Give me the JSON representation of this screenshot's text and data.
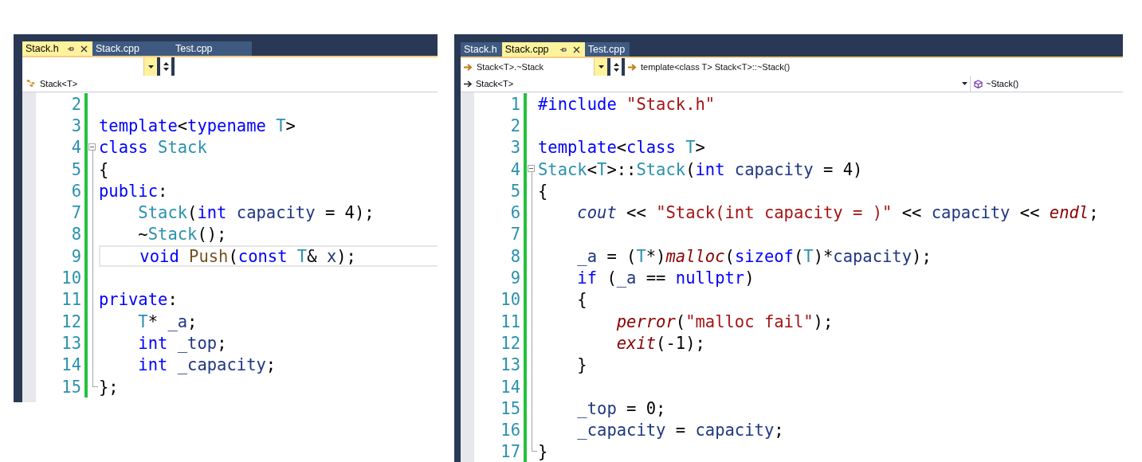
{
  "panes": [
    {
      "tabs": [
        {
          "label": "Stack.h",
          "selected": true
        },
        {
          "label": "Stack.cpp",
          "selected": false
        },
        {
          "label": "Test.cpp",
          "selected": false
        }
      ],
      "nav": {
        "breadcrumb": "Stack<T>"
      },
      "lines": [
        {
          "number": "2",
          "current": false
        },
        {
          "number": "3",
          "current": false,
          "tokens": [
            {
              "kind": "kw",
              "t": "template"
            },
            {
              "kind": "plain",
              "t": "<"
            },
            {
              "kind": "kw",
              "t": "typename"
            },
            {
              "kind": "type",
              "t": " T"
            },
            {
              "kind": "plain",
              "t": ">"
            }
          ]
        },
        {
          "number": "4",
          "current": false,
          "expanded": true,
          "tokens": [
            {
              "kind": "kw",
              "t": "class"
            },
            {
              "kind": "type",
              "t": " Stack"
            }
          ],
          "children": [
            {
              "number": "5",
              "current": false,
              "tokens": [
                {
                  "kind": "plain",
                  "t": "{"
                }
              ]
            },
            {
              "number": "6",
              "current": false,
              "tokens": [
                {
                  "kind": "kw",
                  "t": "public"
                },
                {
                  "kind": "plain",
                  "t": ":"
                }
              ]
            },
            {
              "number": "7",
              "current": false,
              "tokens": [
                {
                  "kind": "type",
                  "t": "    Stack"
                },
                {
                  "kind": "plain",
                  "t": "("
                },
                {
                  "kind": "kw",
                  "t": "int"
                },
                {
                  "kind": "id",
                  "t": " capacity"
                },
                {
                  "kind": "plain",
                  "t": " = 4);"
                }
              ]
            },
            {
              "number": "8",
              "current": false,
              "tokens": [
                {
                  "kind": "plain",
                  "t": "    ~"
                },
                {
                  "kind": "type",
                  "t": "Stack"
                },
                {
                  "kind": "plain",
                  "t": "();"
                }
              ]
            },
            {
              "number": "9",
              "current": true,
              "tokens": [
                {
                  "kind": "kw",
                  "t": "    void"
                },
                {
                  "kind": "fn",
                  "t": " Push"
                },
                {
                  "kind": "plain",
                  "t": "("
                },
                {
                  "kind": "kw",
                  "t": "const"
                },
                {
                  "kind": "type",
                  "t": " T"
                },
                {
                  "kind": "plain",
                  "t": "& "
                },
                {
                  "kind": "id",
                  "t": "x"
                },
                {
                  "kind": "plain",
                  "t": ");"
                }
              ]
            },
            {
              "number": "10",
              "current": false
            },
            {
              "number": "11",
              "current": false,
              "tokens": [
                {
                  "kind": "kw",
                  "t": "private"
                },
                {
                  "kind": "plain",
                  "t": ":"
                }
              ]
            },
            {
              "number": "12",
              "current": false,
              "tokens": [
                {
                  "kind": "type",
                  "t": "    T"
                },
                {
                  "kind": "plain",
                  "t": "* "
                },
                {
                  "kind": "id",
                  "t": "_a"
                },
                {
                  "kind": "plain",
                  "t": ";"
                }
              ]
            },
            {
              "number": "13",
              "current": false,
              "tokens": [
                {
                  "kind": "kw",
                  "t": "    int"
                },
                {
                  "kind": "id",
                  "t": " _top"
                },
                {
                  "kind": "plain",
                  "t": ";"
                }
              ]
            },
            {
              "number": "14",
              "current": false,
              "tokens": [
                {
                  "kind": "kw",
                  "t": "    int"
                },
                {
                  "kind": "id",
                  "t": " _capacity"
                },
                {
                  "kind": "plain",
                  "t": ";"
                }
              ]
            },
            {
              "number": "15",
              "current": false,
              "tokens": [
                {
                  "kind": "plain",
                  "t": "};"
                }
              ]
            }
          ]
        }
      ]
    },
    {
      "tabs": [
        {
          "label": "Stack.h",
          "selected": false
        },
        {
          "label": "Stack.cpp",
          "selected": true
        },
        {
          "label": "Test.cpp",
          "selected": false
        }
      ],
      "nav": {
        "scope": "Stack<T>.~Stack",
        "signature": "template<class T> Stack<T>::~Stack()",
        "breadcrumb": "Stack<T>",
        "member": "~Stack()"
      },
      "lines": [
        {
          "number": "1",
          "current": false,
          "tokens": [
            {
              "kind": "kw",
              "t": "#include"
            },
            {
              "kind": "str",
              "t": " \"Stack.h\""
            }
          ]
        },
        {
          "number": "2",
          "current": false
        },
        {
          "number": "3",
          "current": false,
          "tokens": [
            {
              "kind": "kw",
              "t": "template"
            },
            {
              "kind": "plain",
              "t": "<"
            },
            {
              "kind": "kw",
              "t": "class"
            },
            {
              "kind": "type",
              "t": " T"
            },
            {
              "kind": "plain",
              "t": ">"
            }
          ]
        },
        {
          "number": "4",
          "current": false,
          "expanded": true,
          "tokens": [
            {
              "kind": "type",
              "t": "Stack"
            },
            {
              "kind": "plain",
              "t": "<"
            },
            {
              "kind": "type",
              "t": "T"
            },
            {
              "kind": "plain",
              "t": ">::"
            },
            {
              "kind": "type",
              "t": "Stack"
            },
            {
              "kind": "plain",
              "t": "("
            },
            {
              "kind": "kw",
              "t": "int"
            },
            {
              "kind": "id",
              "t": " capacity"
            },
            {
              "kind": "plain",
              "t": " = 4)"
            }
          ],
          "children": [
            {
              "number": "5",
              "current": false,
              "tokens": [
                {
                  "kind": "plain",
                  "t": "{"
                }
              ]
            },
            {
              "number": "6",
              "current": false,
              "tokens": [
                {
                  "kind": "global",
                  "t": "    cout"
                },
                {
                  "kind": "plain",
                  "t": " << "
                },
                {
                  "kind": "str",
                  "t": "\"Stack(int capacity = )\""
                },
                {
                  "kind": "plain",
                  "t": " << "
                },
                {
                  "kind": "id",
                  "t": "capacity"
                },
                {
                  "kind": "plain",
                  "t": " << "
                },
                {
                  "kind": "lib",
                  "t": "endl"
                },
                {
                  "kind": "plain",
                  "t": ";"
                }
              ]
            },
            {
              "number": "7",
              "current": false
            },
            {
              "number": "8",
              "current": false,
              "tokens": [
                {
                  "kind": "id",
                  "t": "    _a"
                },
                {
                  "kind": "plain",
                  "t": " = ("
                },
                {
                  "kind": "type",
                  "t": "T"
                },
                {
                  "kind": "plain",
                  "t": "*)"
                },
                {
                  "kind": "lib",
                  "t": "malloc"
                },
                {
                  "kind": "plain",
                  "t": "("
                },
                {
                  "kind": "kw",
                  "t": "sizeof"
                },
                {
                  "kind": "plain",
                  "t": "("
                },
                {
                  "kind": "type",
                  "t": "T"
                },
                {
                  "kind": "plain",
                  "t": ")*"
                },
                {
                  "kind": "id",
                  "t": "capacity"
                },
                {
                  "kind": "plain",
                  "t": ");"
                }
              ]
            },
            {
              "number": "9",
              "current": false,
              "tokens": [
                {
                  "kind": "kw",
                  "t": "    if"
                },
                {
                  "kind": "plain",
                  "t": " ("
                },
                {
                  "kind": "id",
                  "t": "_a"
                },
                {
                  "kind": "plain",
                  "t": " == "
                },
                {
                  "kind": "kw",
                  "t": "nullptr"
                },
                {
                  "kind": "plain",
                  "t": ")"
                }
              ]
            },
            {
              "number": "10",
              "current": false,
              "tokens": [
                {
                  "kind": "plain",
                  "t": "    {"
                }
              ]
            },
            {
              "number": "11",
              "current": false,
              "tokens": [
                {
                  "kind": "lib",
                  "t": "        perror"
                },
                {
                  "kind": "plain",
                  "t": "("
                },
                {
                  "kind": "str",
                  "t": "\"malloc fail\""
                },
                {
                  "kind": "plain",
                  "t": ");"
                }
              ]
            },
            {
              "number": "12",
              "current": false,
              "tokens": [
                {
                  "kind": "lib",
                  "t": "        exit"
                },
                {
                  "kind": "plain",
                  "t": "(-1);"
                }
              ]
            },
            {
              "number": "13",
              "current": false,
              "tokens": [
                {
                  "kind": "plain",
                  "t": "    }"
                }
              ]
            },
            {
              "number": "14",
              "current": false
            },
            {
              "number": "15",
              "current": false,
              "tokens": [
                {
                  "kind": "id",
                  "t": "    _top"
                },
                {
                  "kind": "plain",
                  "t": " = 0;"
                }
              ]
            },
            {
              "number": "16",
              "current": false,
              "tokens": [
                {
                  "kind": "id",
                  "t": "    _capacity"
                },
                {
                  "kind": "plain",
                  "t": " = "
                },
                {
                  "kind": "id",
                  "t": "capacity"
                },
                {
                  "kind": "plain",
                  "t": ";"
                }
              ]
            },
            {
              "number": "17",
              "current": false,
              "tokens": [
                {
                  "kind": "plain",
                  "t": "}"
                }
              ]
            }
          ]
        }
      ]
    }
  ]
}
